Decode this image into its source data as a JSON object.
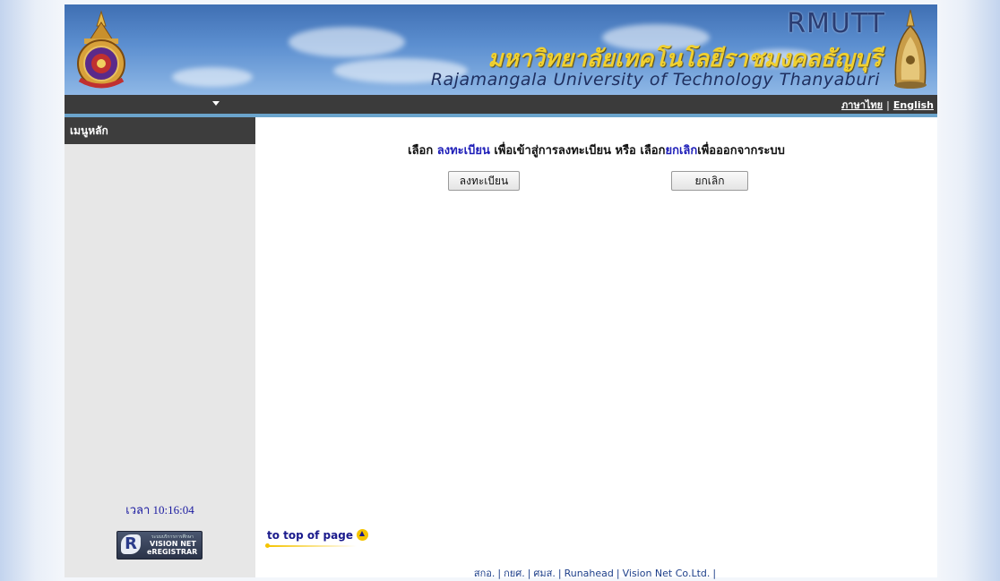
{
  "banner": {
    "brand_short": "RMUTT",
    "brand_thai": "มหาวิทยาลัยเทคโนโลยีราชมงคลธัญบุรี",
    "brand_english": "Rajamangala University of Technology Thanyaburi",
    "emblem_icon": "university-emblem-icon",
    "bell_icon": "bell-icon"
  },
  "nav": {
    "lang_thai": "ภาษาไทย",
    "lang_english": "English",
    "lang_separator": "|"
  },
  "sidebar": {
    "header": "เมนูหลัก",
    "clock_label": "เวลา",
    "clock_time": "10:16:04",
    "logo": {
      "small_text": "ระบบบริการการศึกษา",
      "line1": "VISION NET",
      "line2": "eREGISTRAR",
      "letter": "R"
    }
  },
  "main": {
    "instruction": {
      "part1": "เลือก ",
      "highlight1": "ลงทะเบียน",
      "part2": " เพื่อเข้าสู่การลงทะเบียน หรือ เลือก",
      "highlight2": "ยกเลิก",
      "part3": "เพื่อออกจากระบบ"
    },
    "register_button": "ลงทะเบียน",
    "cancel_button": "ยกเลิก",
    "to_top_label": "to top of page"
  },
  "footer": {
    "links": [
      "สกอ.",
      "กยศ.",
      "ศมส.",
      "Runahead",
      "Vision Net Co.Ltd."
    ],
    "separator": "|"
  },
  "colors": {
    "link_blue": "#1d1db8",
    "nav_dark": "#3b3b3b",
    "accent_blue_line": "#6ba4cc",
    "sidebar_bg": "#e7e7e7"
  }
}
